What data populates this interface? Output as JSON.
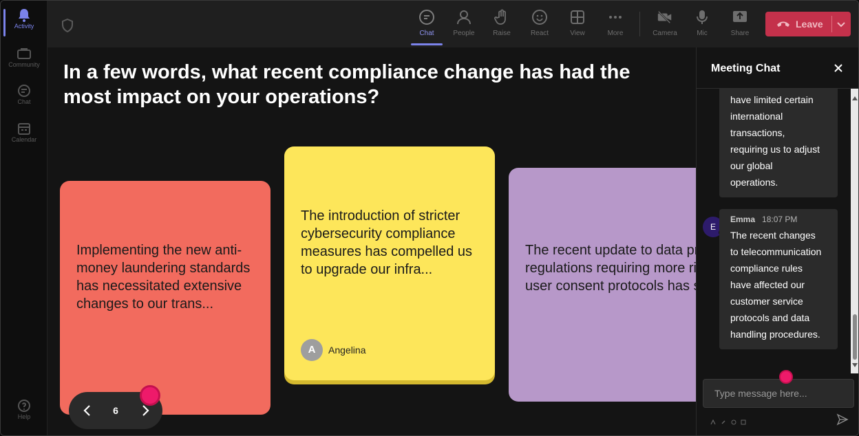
{
  "rail": {
    "items": [
      {
        "label": "Activity",
        "icon": "bell-icon"
      },
      {
        "label": "Community",
        "icon": "community-icon"
      },
      {
        "label": "Chat",
        "icon": "chat-icon"
      },
      {
        "label": "Calendar",
        "icon": "calendar-icon"
      },
      {
        "label": "Help",
        "icon": "help-icon"
      }
    ]
  },
  "toolbar": {
    "buttons": [
      {
        "label": "Chat",
        "icon": "chat-icon"
      },
      {
        "label": "People",
        "icon": "people-icon"
      },
      {
        "label": "Raise",
        "icon": "hand-icon"
      },
      {
        "label": "React",
        "icon": "smiley-icon"
      },
      {
        "label": "View",
        "icon": "grid-icon"
      },
      {
        "label": "More",
        "icon": "more-icon"
      },
      {
        "label": "Camera",
        "icon": "camera-off-icon"
      },
      {
        "label": "Mic",
        "icon": "mic-icon"
      },
      {
        "label": "Share",
        "icon": "share-icon"
      }
    ],
    "leave_label": "Leave"
  },
  "stage": {
    "question": "In a few words, what recent compliance change has had the most impact on your operations?",
    "cards": [
      {
        "text": "Implementing the new anti-money laundering standards has necessitated extensive changes to our trans...",
        "color": "#f26b5e"
      },
      {
        "text": "The introduction of stricter cybersecurity compliance measures has compelled us to upgrade our infra...",
        "color": "#fde65a",
        "author": "Angelina",
        "author_initial": "A"
      },
      {
        "text": "The recent update to data privacy regulations requiring more rigorous user consent protocols has sig...",
        "color": "#b798c9"
      }
    ],
    "pager": {
      "page": "6"
    }
  },
  "chat": {
    "title": "Meeting Chat",
    "messages": [
      {
        "text_lines": [
          "have limited certain",
          "international",
          "transactions,",
          "requiring us to adjust",
          "our global",
          "operations."
        ]
      },
      {
        "sender": "Emma",
        "initial": "E",
        "time": "18:07 PM",
        "text_lines": [
          "The recent changes",
          "to telecommunication",
          "compliance rules",
          "have affected our",
          "customer service",
          "protocols and data",
          "handling procedures."
        ]
      }
    ],
    "input_placeholder": "Type message here..."
  },
  "colors": {
    "accent": "#7b83eb",
    "leave": "#c4314b",
    "cursor": "#ee1a6a"
  }
}
